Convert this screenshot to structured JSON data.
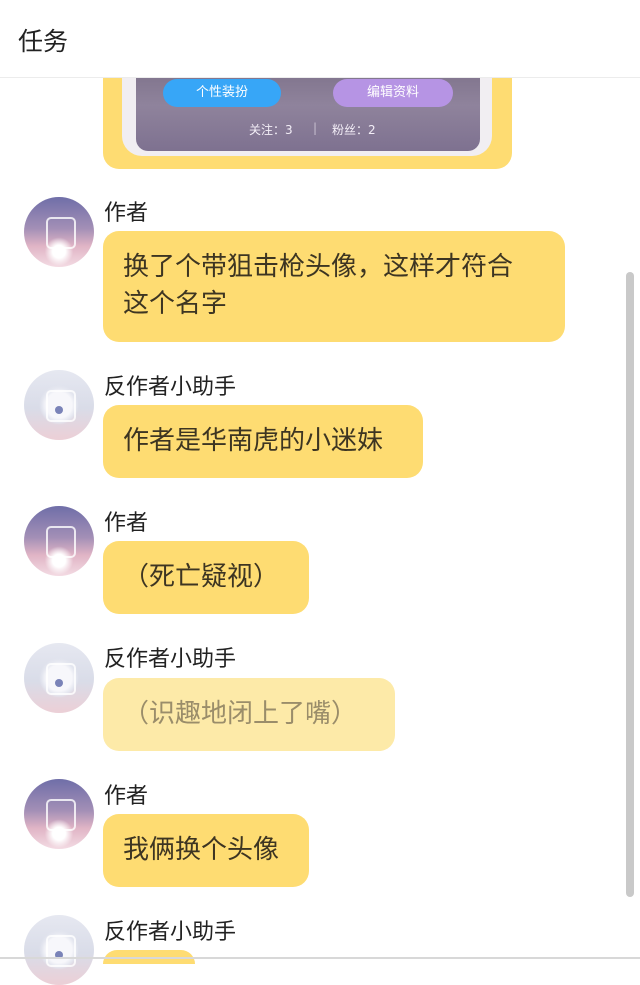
{
  "header": {
    "title": "任务"
  },
  "profile_card": {
    "button_style": "个性装扮",
    "button_edit": "编辑资料",
    "following": "关注：3",
    "separator": "|",
    "fans": "粉丝：2"
  },
  "messages": [
    {
      "sender": "作者",
      "text": "换了个带狙击枪头像，这样才符合\n这个名字"
    },
    {
      "sender": "反作者小助手",
      "text": "作者是华南虎的小迷妹"
    },
    {
      "sender": "作者",
      "text": "（死亡疑视）"
    },
    {
      "sender": "反作者小助手",
      "text": "（识趣地闭上了嘴）"
    },
    {
      "sender": "作者",
      "text": "我俩换个头像"
    },
    {
      "sender": "反作者小助手",
      "text": ""
    }
  ],
  "colors": {
    "bubble": "#fedc72",
    "bubble_faded": "#fdeaa8",
    "blue_button": "#37a6f7",
    "purple_button": "#b694e4"
  }
}
